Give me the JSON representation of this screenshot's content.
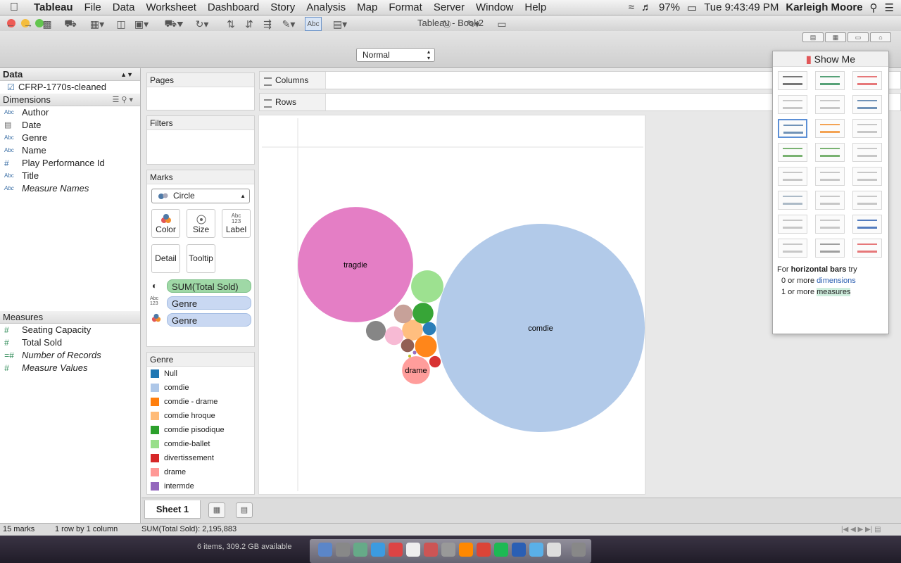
{
  "menubar": {
    "items": [
      "Tableau",
      "File",
      "Data",
      "Worksheet",
      "Dashboard",
      "Story",
      "Analysis",
      "Map",
      "Format",
      "Server",
      "Window",
      "Help"
    ],
    "battery": "97%",
    "clock": "Tue 9:43:49 PM",
    "user": "Karleigh Moore"
  },
  "window": {
    "title": "Tableau - Book2"
  },
  "toolbar": {
    "view_mode": "Normal"
  },
  "datapane": {
    "header": "Data",
    "datasource": "CFRP-1770s-cleaned",
    "dimensions_header": "Dimensions",
    "dimensions": [
      {
        "type": "Abc",
        "name": "Author"
      },
      {
        "type": "date",
        "name": "Date"
      },
      {
        "type": "Abc",
        "name": "Genre"
      },
      {
        "type": "Abc",
        "name": "Name"
      },
      {
        "type": "#",
        "name": "Play Performance Id"
      },
      {
        "type": "Abc",
        "name": "Title"
      },
      {
        "type": "Abc",
        "name": "Measure Names"
      }
    ],
    "measures_header": "Measures",
    "measures": [
      {
        "type": "#",
        "name": "Seating Capacity"
      },
      {
        "type": "#",
        "name": "Total Sold"
      },
      {
        "type": "=#",
        "name": "Number of Records"
      },
      {
        "type": "#",
        "name": "Measure Values"
      }
    ]
  },
  "shelves": {
    "pages": "Pages",
    "filters": "Filters",
    "marks": "Marks",
    "mark_type": "Circle",
    "color": "Color",
    "size": "Size",
    "label": "Label",
    "detail": "Detail",
    "tooltip": "Tooltip",
    "pills": [
      "SUM(Total Sold)",
      "Genre",
      "Genre"
    ],
    "columns": "Columns",
    "rows": "Rows"
  },
  "legend": {
    "title": "Genre",
    "items": [
      {
        "name": "Null",
        "color": "#1f77b4"
      },
      {
        "name": "comdie",
        "color": "#aec7e8"
      },
      {
        "name": "comdie - drame",
        "color": "#ff7f0e"
      },
      {
        "name": "comdie hroque",
        "color": "#ffbb78"
      },
      {
        "name": "comdie pisodique",
        "color": "#2ca02c"
      },
      {
        "name": "comdie-ballet",
        "color": "#98df8a"
      },
      {
        "name": "divertissement",
        "color": "#d62728"
      },
      {
        "name": "drame",
        "color": "#ff9896"
      },
      {
        "name": "intermde",
        "color": "#9467bd"
      }
    ]
  },
  "chart_data": {
    "type": "bubble",
    "size_measure": "SUM(Total Sold)",
    "color_dimension": "Genre",
    "label_dimension": "Genre",
    "bubbles": [
      {
        "genre": "comdie",
        "label": "comdie",
        "relative_size": 1.0,
        "color": "#aec7e8"
      },
      {
        "genre": "tragdie",
        "label": "tragdie",
        "relative_size": 0.306,
        "color": "#e377c2"
      },
      {
        "genre": "drame",
        "label": "drame",
        "relative_size": 0.018,
        "color": "#ff9896"
      },
      {
        "genre": "comdie-ballet",
        "label": "",
        "relative_size": 0.024,
        "color": "#98df8a"
      },
      {
        "genre": "comdie - drame",
        "label": "",
        "relative_size": 0.011,
        "color": "#ff7f0e"
      },
      {
        "genre": "comdie hroque",
        "label": "",
        "relative_size": 0.01,
        "color": "#ffbb78"
      },
      {
        "genre": "comdie pisodique",
        "label": "",
        "relative_size": 0.01,
        "color": "#2ca02c"
      },
      {
        "genre": "",
        "label": "",
        "relative_size": 0.009,
        "color": "#7f7f7f"
      },
      {
        "genre": "",
        "label": "",
        "relative_size": 0.008,
        "color": "#c49c94"
      },
      {
        "genre": "",
        "label": "",
        "relative_size": 0.008,
        "color": "#f7b6d2"
      },
      {
        "genre": "Null",
        "label": "",
        "relative_size": 0.004,
        "color": "#1f77b4"
      },
      {
        "genre": "",
        "label": "",
        "relative_size": 0.004,
        "color": "#8c564b"
      },
      {
        "genre": "divertissement",
        "label": "",
        "relative_size": 0.003,
        "color": "#d62728"
      },
      {
        "genre": "intermde",
        "label": "",
        "relative_size": 0.0003,
        "color": "#9467bd"
      },
      {
        "genre": "",
        "label": "",
        "relative_size": 0.0002,
        "color": "#bcbd22"
      }
    ]
  },
  "showme": {
    "title": "Show Me",
    "hint_prefix": "For ",
    "hint_bold": "horizontal bars",
    "hint_suffix": " try",
    "line1_prefix": "0 or more ",
    "line1_term": "dimensions",
    "line2_prefix": "1 or more ",
    "line2_term": "measures"
  },
  "sheet": {
    "tab": "Sheet 1"
  },
  "status": {
    "marks": "15 marks",
    "layout": "1 row by 1 column",
    "sum": "SUM(Total Sold): 2,195,883"
  },
  "desktop": {
    "storage": "6 items, 309.2 GB available"
  }
}
